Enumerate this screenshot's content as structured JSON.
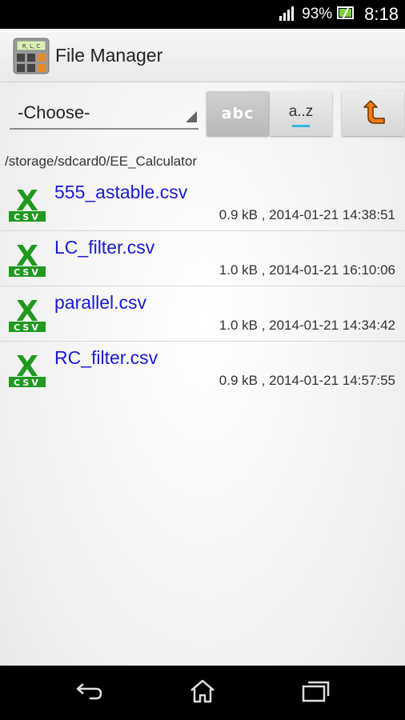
{
  "status_bar": {
    "battery_percent": "93%",
    "time": "8:18"
  },
  "action_bar": {
    "title": "File Manager",
    "icon_label": "R, L, C"
  },
  "toolbar": {
    "spinner_value": "-Choose-",
    "sort_alpha_label": "abc",
    "sort_az_label": "a..z"
  },
  "current_path": "/storage/sdcard0/EE_Calculator",
  "files": [
    {
      "name": "555_astable.csv",
      "meta": "0.9 kB , 2014-01-21 14:38:51"
    },
    {
      "name": "LC_filter.csv",
      "meta": "1.0 kB , 2014-01-21 16:10:06"
    },
    {
      "name": "parallel.csv",
      "meta": "1.0 kB , 2014-01-21 14:34:42"
    },
    {
      "name": "RC_filter.csv",
      "meta": "0.9 kB , 2014-01-21 14:57:55"
    }
  ],
  "icons": {
    "file_icon": "csv-file-icon",
    "file_icon_letter": "X",
    "file_icon_tag": "CSV"
  },
  "colors": {
    "file_name": "#1a1ad0",
    "csv_green": "#1f9a1f",
    "accent": "#33b5e5",
    "up_arrow": "#f07a12"
  }
}
